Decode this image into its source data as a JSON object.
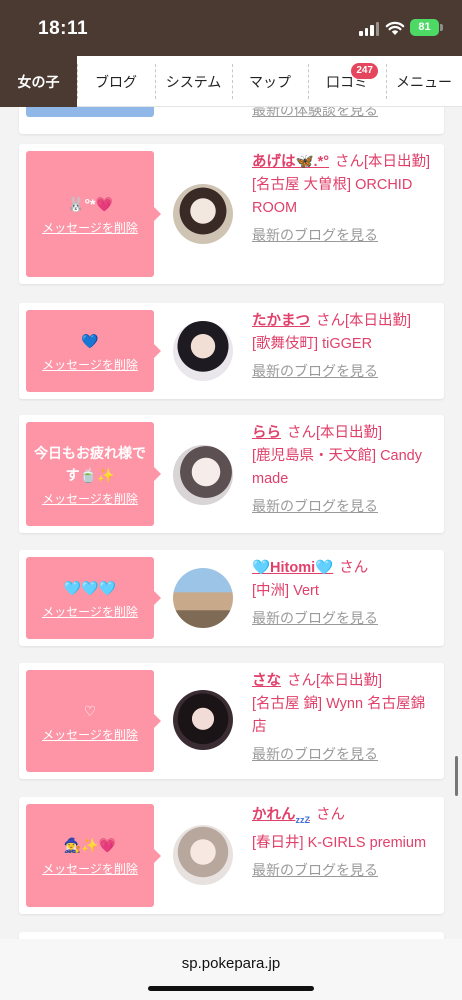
{
  "status": {
    "time": "18:11",
    "battery": "81"
  },
  "nav": {
    "tabs": [
      {
        "label": "女の子"
      },
      {
        "label": "ブログ"
      },
      {
        "label": "システム"
      },
      {
        "label": "マップ"
      },
      {
        "label": "口コミ",
        "badge": "247"
      },
      {
        "label": "メニュー"
      }
    ]
  },
  "partial_top": {
    "blog_link": "最新の体験談を見る"
  },
  "cards": [
    {
      "message": "🐰°*💗",
      "delete": "メッセージを削除",
      "name": "あげは🦋.*°",
      "san": "さん",
      "status": "[本日出勤]",
      "loc": "[名古屋 大曽根] ORCHID ROOM",
      "blog": "最新のブログを見る"
    },
    {
      "message": "💙",
      "delete": "メッセージを削除",
      "name": "たかまつ",
      "san": "さん",
      "status": "[本日出勤]",
      "loc": "[歌舞伎町] tiGGER",
      "blog": "最新のブログを見る"
    },
    {
      "message": "今日もお疲れ様です🍵✨",
      "delete": "メッセージを削除",
      "name": "らら",
      "san": "さん",
      "status": "[本日出勤]",
      "loc": "[鹿児島県・天文館] Candy made",
      "blog": "最新のブログを見る"
    },
    {
      "message": "🩵🩵🩵",
      "delete": "メッセージを削除",
      "name": "🩵Hitomi🩵",
      "san": "さん",
      "status": "",
      "loc": "[中洲] Vert",
      "blog": "最新のブログを見る"
    },
    {
      "message": "♡",
      "delete": "メッセージを削除",
      "name": "さな",
      "san": "さん",
      "status": "[本日出勤]",
      "loc": "[名古屋 錦] Wynn 名古屋錦店",
      "blog": "最新のブログを見る"
    },
    {
      "message": "🧙‍♀️✨💗",
      "delete": "メッセージを削除",
      "name": "かれん",
      "name_suffix": "zzZ",
      "san": "さん",
      "status": "",
      "loc": "[春日井] K-GIRLS premium",
      "blog": "最新のブログを見る"
    }
  ],
  "urlbar": {
    "url": "sp.pokepara.jp"
  }
}
